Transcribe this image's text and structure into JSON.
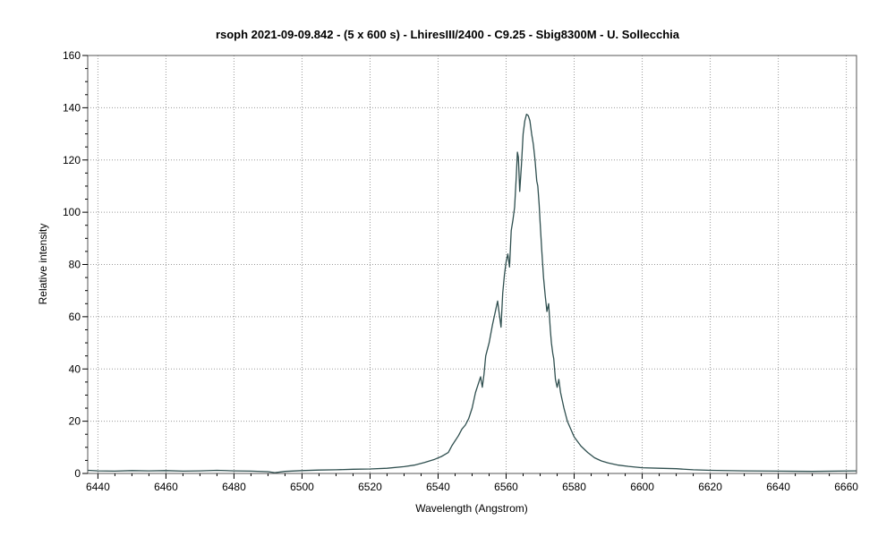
{
  "chart_data": {
    "type": "line",
    "title": "rsoph  2021-09-09.842  - (5 x 600 s) - LhiresIII/2400 - C9.25 - Sbig8300M - U. Sollecchia",
    "xlabel": "Wavelength (Angstrom)",
    "ylabel": "Relative intensity",
    "xlim": [
      6437,
      6663
    ],
    "ylim": [
      0,
      160
    ],
    "xticks": [
      6440,
      6460,
      6480,
      6500,
      6520,
      6540,
      6560,
      6580,
      6600,
      6620,
      6640,
      6660
    ],
    "yticks": [
      0,
      20,
      40,
      60,
      80,
      100,
      120,
      140,
      160
    ],
    "grid": true,
    "colors": {
      "line": "#2f4f4f",
      "grid": "#9a9a9a",
      "axis": "#000000"
    },
    "series": [
      {
        "x": [
          6437,
          6440,
          6445,
          6450,
          6455,
          6460,
          6465,
          6470,
          6475,
          6480,
          6485,
          6490,
          6492,
          6495,
          6500,
          6505,
          6510,
          6515,
          6520,
          6525,
          6530,
          6533,
          6536,
          6539,
          6541,
          6543,
          6544,
          6545,
          6546,
          6547,
          6548,
          6549,
          6550,
          6551,
          6552,
          6552.5,
          6553,
          6553.5,
          6554,
          6555,
          6556,
          6557,
          6557.5,
          6558,
          6558.5,
          6559,
          6559.5,
          6560,
          6560.5,
          6561,
          6561.5,
          6562,
          6562.5,
          6563,
          6563.3,
          6563.6,
          6564,
          6564.5,
          6565,
          6565.5,
          6566,
          6566.5,
          6567,
          6567.5,
          6568,
          6568.5,
          6569,
          6569.3,
          6569.7,
          6570,
          6570.5,
          6571,
          6571.5,
          6572,
          6572.5,
          6573,
          6573.3,
          6573.7,
          6574,
          6574.5,
          6575,
          6575.5,
          6576,
          6577,
          6578,
          6579,
          6580,
          6582,
          6584,
          6586,
          6588,
          6590,
          6593,
          6596,
          6600,
          6605,
          6610,
          6615,
          6620,
          6630,
          6640,
          6650,
          6663
        ],
        "y": [
          1.2,
          1.0,
          0.9,
          1.1,
          1.0,
          1.1,
          0.9,
          1.0,
          1.2,
          1.0,
          0.9,
          0.7,
          0.3,
          0.8,
          1.1,
          1.3,
          1.4,
          1.6,
          1.7,
          2.0,
          2.6,
          3.2,
          4.2,
          5.4,
          6.5,
          8.0,
          10.5,
          12.5,
          14.5,
          17.0,
          18.5,
          21.0,
          25.0,
          31.0,
          35.0,
          37.0,
          33.0,
          38.0,
          45.0,
          50.0,
          57.0,
          63.0,
          66.0,
          61.0,
          56.0,
          69.0,
          76.0,
          81.0,
          84.0,
          79.0,
          93.0,
          97.0,
          102.0,
          114.0,
          123.0,
          121.0,
          108.0,
          118.0,
          130.0,
          135.0,
          137.5,
          137.0,
          135.0,
          130.0,
          126.0,
          120.0,
          112.0,
          110.0,
          103.0,
          96.0,
          85.0,
          75.0,
          68.0,
          62.0,
          65.0,
          55.0,
          50.0,
          46.0,
          44.0,
          36.0,
          33.0,
          36.0,
          31.0,
          25.0,
          20.0,
          17.0,
          14.0,
          10.5,
          8.0,
          6.0,
          4.8,
          4.0,
          3.2,
          2.7,
          2.2,
          2.0,
          1.8,
          1.4,
          1.2,
          1.0,
          0.9,
          0.8,
          1.0
        ]
      }
    ]
  }
}
